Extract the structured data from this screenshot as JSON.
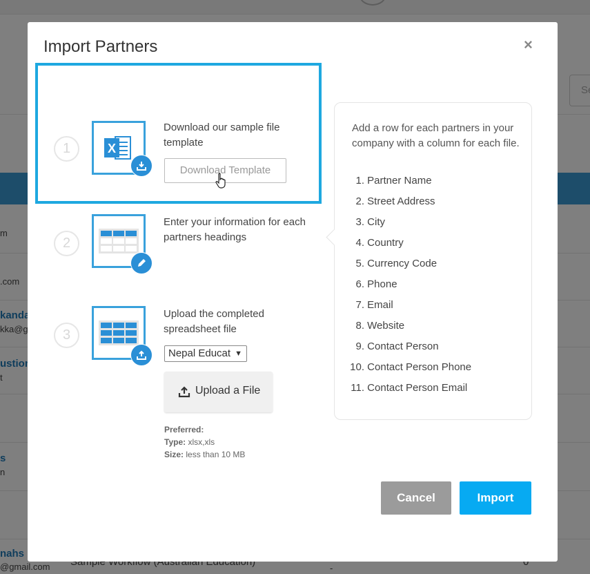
{
  "background": {
    "search_placeholder": "Se",
    "rows": [
      {
        "line1": "m",
        "line2": ""
      },
      {
        "line1": ".com",
        "line2": ""
      },
      {
        "line1": "kanda",
        "line2": "kka@gr"
      },
      {
        "line1": "ustion",
        "line2": "t"
      },
      {
        "line1": "s",
        "line2": "n"
      },
      {
        "line1": "nahs",
        "line2": "@gmail.com"
      }
    ],
    "bottom_workflow": "Sample Workflow (Australian Education)",
    "bottom_dash": "-",
    "bottom_count": "0"
  },
  "modal": {
    "title": "Import Partners",
    "close_symbol": "×",
    "steps": [
      {
        "number": "1",
        "text": "Download our sample file template",
        "button_label": "Download Template"
      },
      {
        "number": "2",
        "text": "Enter your information for each partners headings"
      },
      {
        "number": "3",
        "text": "Upload the completed spreadsheet file",
        "select_value": "Nepal Educat",
        "upload_label": "Upload a File",
        "preferred_label": "Preferred:",
        "type_label": "Type:",
        "type_value": "xlsx,xls",
        "size_label": "Size:",
        "size_value": "less than 10 MB"
      }
    ],
    "info": {
      "intro": "Add a row for each partners in your company with a column for each file.",
      "fields": [
        {
          "n": "1.",
          "label": "Partner Name"
        },
        {
          "n": "2.",
          "label": "Street Address"
        },
        {
          "n": "3.",
          "label": "City"
        },
        {
          "n": "4.",
          "label": "Country"
        },
        {
          "n": "5.",
          "label": "Currency Code"
        },
        {
          "n": "6.",
          "label": "Phone"
        },
        {
          "n": "7.",
          "label": "Email"
        },
        {
          "n": "8.",
          "label": "Website"
        },
        {
          "n": "9.",
          "label": "Contact Person"
        },
        {
          "n": "10.",
          "label": "Contact Person Phone"
        },
        {
          "n": "11.",
          "label": "Contact Person Email"
        }
      ]
    },
    "cancel_label": "Cancel",
    "import_label": "Import"
  },
  "colors": {
    "highlight": "#1ea8e0",
    "import_button": "#07aaf2",
    "cancel_button": "#9b9b9b",
    "icon_blue": "#2a8fd6"
  },
  "icons": [
    "excel-icon",
    "download-icon",
    "table-icon",
    "pencil-icon",
    "upload-icon",
    "hand-cursor-icon"
  ]
}
